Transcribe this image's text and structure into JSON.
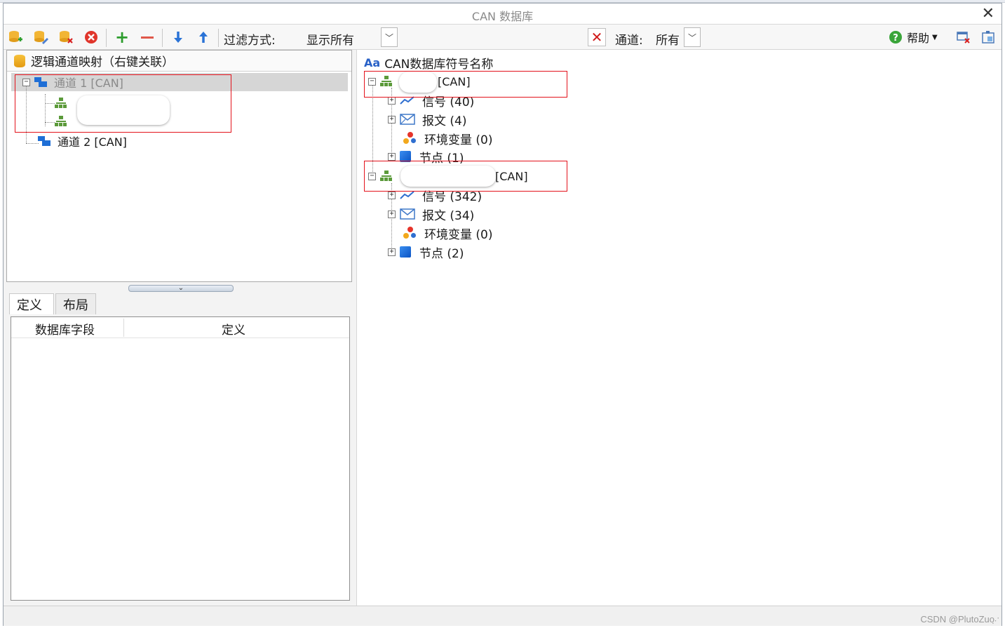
{
  "window": {
    "title": "CAN 数据库"
  },
  "toolbar": {
    "filter_label": "过滤方式:",
    "filter_value": "显示所有",
    "channel_label": "通道:",
    "channel_value": "所有",
    "help_label": "帮助"
  },
  "left_tree": {
    "header": "逻辑通道映射（右键关联）",
    "items": [
      {
        "label": "通道 1 [CAN]"
      },
      {
        "label": "通道 2 [CAN]"
      }
    ]
  },
  "tabs": [
    {
      "label": "定义"
    },
    {
      "label": "布局"
    }
  ],
  "grid": {
    "columns": [
      "数据库字段",
      "定义"
    ]
  },
  "right_tree": {
    "header": "CAN数据库符号名称",
    "header_icon_text": "Aa",
    "db1": {
      "tag": "[CAN]",
      "children": [
        "信号 (40)",
        "报文 (4)",
        "环境变量 (0)",
        "节点 (1)"
      ]
    },
    "db2": {
      "tag": "[CAN]",
      "children": [
        "信号 (342)",
        "报文 (34)",
        "环境变量 (0)",
        "节点 (2)"
      ]
    }
  },
  "status": {
    "watermark": "CSDN @PlutoZuo"
  },
  "colors": {
    "accent": "#1f6fd6",
    "highlight_box": "#e3121b",
    "selection": "#d6d6d6"
  }
}
